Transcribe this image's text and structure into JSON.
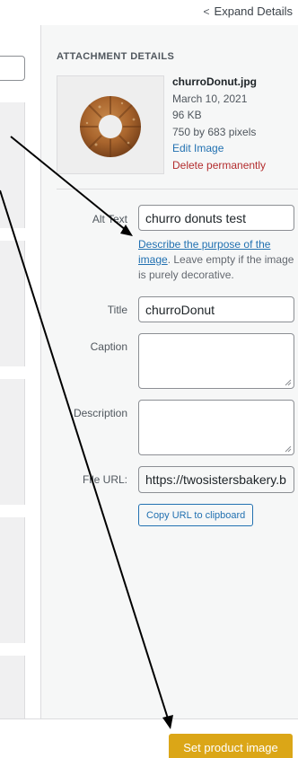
{
  "header": {
    "expand_label": "Expand Details",
    "chevron_glyph": "<"
  },
  "attachment": {
    "heading": "ATTACHMENT DETAILS",
    "filename": "churroDonut.jpg",
    "date": "March 10, 2021",
    "filesize": "96 KB",
    "dimensions": "750 by 683 pixels",
    "edit_link": "Edit Image",
    "delete_link": "Delete permanently",
    "thumbnail_icon": "donut-thumbnail"
  },
  "fields": {
    "alt_text": {
      "label": "Alt Text",
      "value": "churro donuts test"
    },
    "alt_help": {
      "link_text": "Describe the purpose of the image",
      "rest": ". Leave empty if the image is purely decorative."
    },
    "title": {
      "label": "Title",
      "value": "churroDonut"
    },
    "caption": {
      "label": "Caption",
      "value": ""
    },
    "description": {
      "label": "Description",
      "value": ""
    },
    "file_url": {
      "label": "File URL:",
      "value": "https://twosistersbakery.b"
    },
    "copy_button": "Copy URL to clipboard"
  },
  "footer": {
    "set_button": "Set product image"
  },
  "colors": {
    "accent": "#2271b1",
    "danger": "#b32d2e",
    "primary_button": "#dba617"
  }
}
